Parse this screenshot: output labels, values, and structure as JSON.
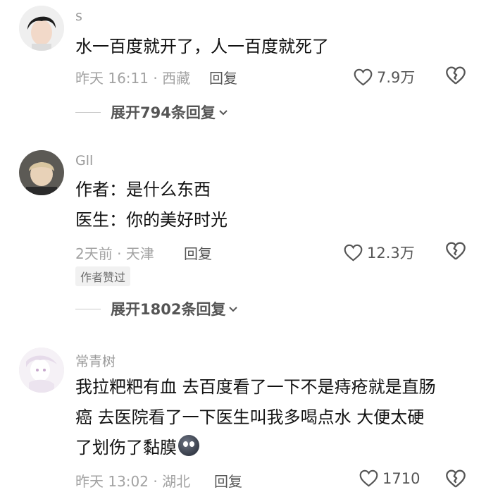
{
  "comments": [
    {
      "username": "s",
      "lines": [
        "水一百度就开了，人一百度就死了"
      ],
      "meta": "昨天 16:11 · 西藏",
      "reply_label": "回复",
      "likes": "7.9万",
      "expand_label": "展开794条回复"
    },
    {
      "username": "Gll",
      "lines": [
        "作者：是什么东西",
        "医生：你的美好时光"
      ],
      "meta": "2天前 · 天津",
      "reply_label": "回复",
      "likes": "12.3万",
      "badge": "作者赞过",
      "expand_label": "展开1802条回复"
    },
    {
      "username": "常青树",
      "lines": [
        "我拉粑粑有血 去百度看了一下不是痔疮就是直肠",
        "癌 去医院看了一下医生叫我多喝点水 大便太硬",
        "了划伤了黏膜"
      ],
      "emoji": "dark-face-emoji",
      "meta": "昨天 13:02 · 湖北",
      "reply_label": "回复",
      "likes": "1710"
    }
  ],
  "icons": {
    "like": "heart-outline-icon",
    "dislike": "broken-heart-icon",
    "expand": "chevron-down-icon"
  },
  "colors": {
    "username": "#9a9a9a",
    "meta": "#a2a2a2",
    "text": "#111111",
    "background": "#ffffff"
  }
}
